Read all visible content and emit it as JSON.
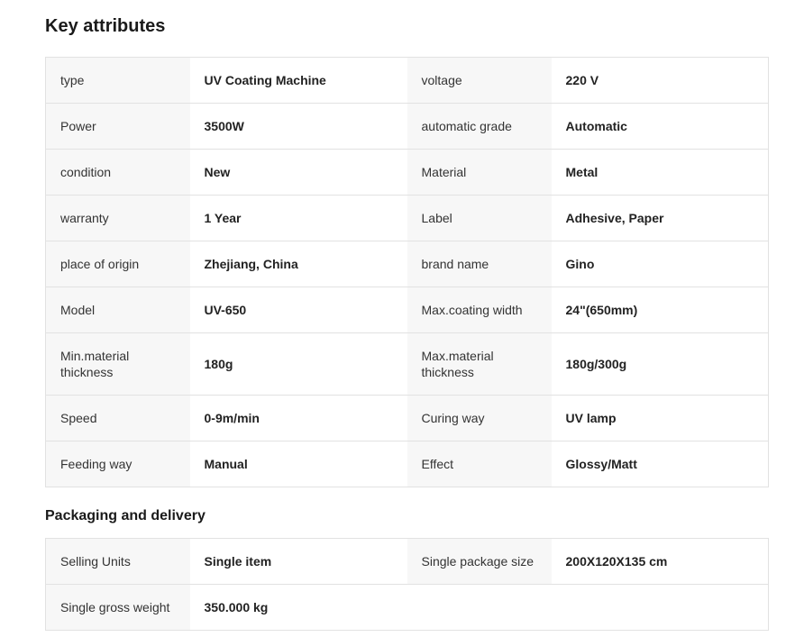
{
  "key_attributes": {
    "title": "Key attributes",
    "rows": [
      [
        {
          "k": "type",
          "v": "UV Coating Machine"
        },
        {
          "k": "voltage",
          "v": "220 V"
        }
      ],
      [
        {
          "k": "Power",
          "v": "3500W"
        },
        {
          "k": "automatic grade",
          "v": "Automatic"
        }
      ],
      [
        {
          "k": "condition",
          "v": "New"
        },
        {
          "k": "Material",
          "v": "Metal"
        }
      ],
      [
        {
          "k": "warranty",
          "v": "1 Year"
        },
        {
          "k": "Label",
          "v": "Adhesive, Paper"
        }
      ],
      [
        {
          "k": "place of origin",
          "v": "Zhejiang, China"
        },
        {
          "k": "brand name",
          "v": "Gino"
        }
      ],
      [
        {
          "k": "Model",
          "v": "UV-650"
        },
        {
          "k": "Max.coating width",
          "v": "24\"(650mm)"
        }
      ],
      [
        {
          "k": "Min.material thickness",
          "v": "180g"
        },
        {
          "k": "Max.material thickness",
          "v": "180g/300g"
        }
      ],
      [
        {
          "k": "Speed",
          "v": "0-9m/min"
        },
        {
          "k": "Curing way",
          "v": "UV lamp"
        }
      ],
      [
        {
          "k": "Feeding way",
          "v": "Manual"
        },
        {
          "k": "Effect",
          "v": "Glossy/Matt"
        }
      ]
    ]
  },
  "packaging": {
    "title": "Packaging and delivery",
    "rows": [
      [
        {
          "k": "Selling Units",
          "v": "Single item"
        },
        {
          "k": "Single package size",
          "v": "200X120X135 cm"
        }
      ],
      [
        {
          "k": "Single gross weight",
          "v": "350.000 kg"
        },
        {
          "k": "",
          "v": ""
        }
      ]
    ]
  }
}
